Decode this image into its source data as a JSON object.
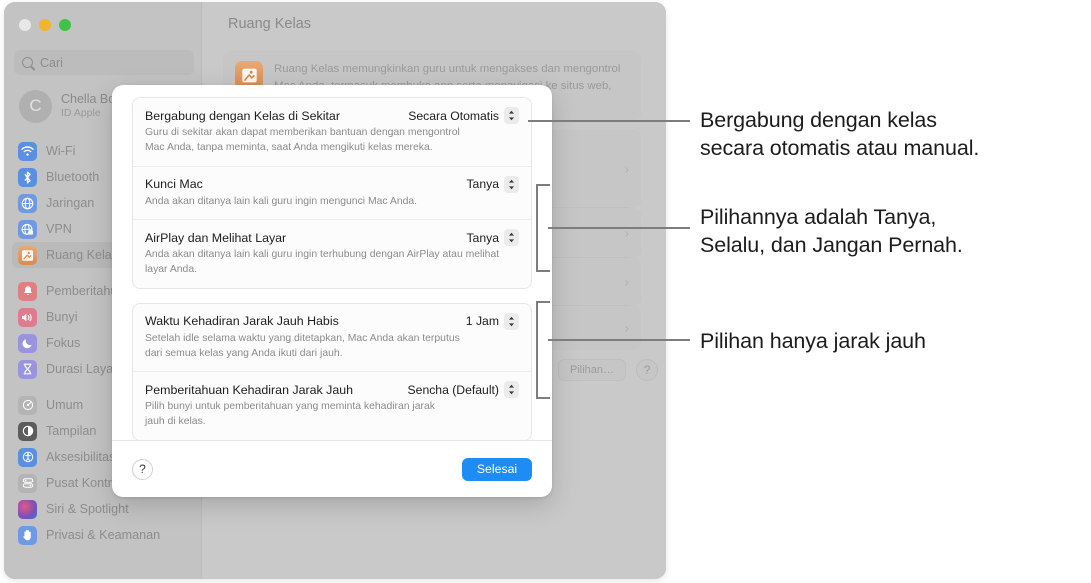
{
  "window": {
    "traffic_lights": [
      "close",
      "minimize",
      "zoom"
    ],
    "search": {
      "placeholder": "Cari",
      "icon": "search-icon"
    },
    "account": {
      "initial": "C",
      "name": "Chella Boe",
      "subtitle": "ID Apple"
    },
    "sidebar_groups": [
      {
        "items": [
          {
            "label": "Wi-Fi",
            "icon": "wifi-icon",
            "color": "#5b8fe0",
            "selected": false
          },
          {
            "label": "Bluetooth",
            "icon": "bluetooth-icon",
            "color": "#5b8fe0",
            "selected": false
          },
          {
            "label": "Jaringan",
            "icon": "network-globe-icon",
            "color": "#6f9ae3",
            "selected": false
          },
          {
            "label": "VPN",
            "icon": "vpn-globe-icon",
            "color": "#6f9ae3",
            "selected": false
          },
          {
            "label": "Ruang Kelas",
            "icon": "classroom-icon",
            "color": "#d98b52",
            "selected": true
          }
        ]
      },
      {
        "items": [
          {
            "label": "Pemberitahuan",
            "icon": "bell-icon",
            "color": "#e07f7f",
            "selected": false
          },
          {
            "label": "Bunyi",
            "icon": "speaker-icon",
            "color": "#e07a8f",
            "selected": false
          },
          {
            "label": "Fokus",
            "icon": "moon-icon",
            "color": "#9a93dd",
            "selected": false
          },
          {
            "label": "Durasi Layar",
            "icon": "hourglass-icon",
            "color": "#9a93dd",
            "selected": false
          }
        ]
      },
      {
        "items": [
          {
            "label": "Umum",
            "icon": "gear-icon",
            "color": "#b4b4b4",
            "selected": false
          },
          {
            "label": "Tampilan",
            "icon": "appearance-icon",
            "color": "#5c5c5c",
            "selected": false
          },
          {
            "label": "Aksesibilitas",
            "icon": "accessibility-icon",
            "color": "#5b8fe0",
            "selected": false
          },
          {
            "label": "Pusat Kontrol",
            "icon": "control-center-icon",
            "color": "#b4b4b4",
            "selected": false
          },
          {
            "label": "Siri & Spotlight",
            "icon": "siri-icon",
            "color": "#9c5fb0",
            "selected": false
          },
          {
            "label": "Privasi & Keamanan",
            "icon": "privacy-hand-icon",
            "color": "#6f9ae3",
            "selected": false
          }
        ]
      }
    ],
    "pane": {
      "title": "Ruang Kelas",
      "info_icon": "classroom-icon",
      "info_text": "Ruang Kelas memungkinkan guru untuk mengakses dan mengontrol Mac Anda, termasuk membuka app serta menavigasi ke situs web, bab, dan",
      "rows": [
        {
          "chevron": "chevron-right-icon"
        },
        {
          "chevron": "chevron-right-icon"
        },
        {
          "chevron": "chevron-right-icon"
        },
        {
          "chevron": "chevron-right-icon"
        }
      ],
      "options_button": "Pilihan…",
      "help_button": "?"
    }
  },
  "sheet": {
    "groups": [
      {
        "rows": [
          {
            "title": "Bergabung dengan Kelas di Sekitar",
            "description": "Guru di sekitar akan dapat memberikan bantuan dengan mengontrol Mac Anda, tanpa meminta, saat Anda mengikuti kelas mereka.",
            "value": "Secara Otomatis",
            "control": "popup-button"
          },
          {
            "title": "Kunci Mac",
            "description": "Anda akan ditanya lain kali guru ingin mengunci Mac Anda.",
            "value": "Tanya",
            "control": "popup-button"
          },
          {
            "title": "AirPlay dan Melihat Layar",
            "description": "Anda akan ditanya lain kali guru ingin terhubung dengan AirPlay atau melihat layar Anda.",
            "value": "Tanya",
            "control": "popup-button"
          }
        ]
      },
      {
        "rows": [
          {
            "title": "Waktu Kehadiran Jarak Jauh Habis",
            "description": "Setelah idle selama waktu yang ditetapkan, Mac Anda akan terputus dari semua kelas yang Anda ikuti dari jauh.",
            "value": "1 Jam",
            "control": "popup-button"
          },
          {
            "title": "Pemberitahuan Kehadiran Jarak Jauh",
            "description": "Pilih bunyi untuk pemberitahuan yang meminta kehadiran jarak jauh di kelas.",
            "value": "Sencha (Default)",
            "control": "popup-button"
          }
        ]
      }
    ],
    "footer": {
      "help_label": "?",
      "done_label": "Selesai",
      "accent_color": "#1d8cf5"
    }
  },
  "callouts": [
    {
      "text": "Bergabung dengan kelas\nsecara otomatis atau manual.",
      "connector": "line"
    },
    {
      "text": "Pilihannya adalah Tanya,\nSelalu, dan Jangan Pernah.",
      "connector": "bracket"
    },
    {
      "text": "Pilihan hanya jarak jauh",
      "connector": "bracket"
    }
  ]
}
